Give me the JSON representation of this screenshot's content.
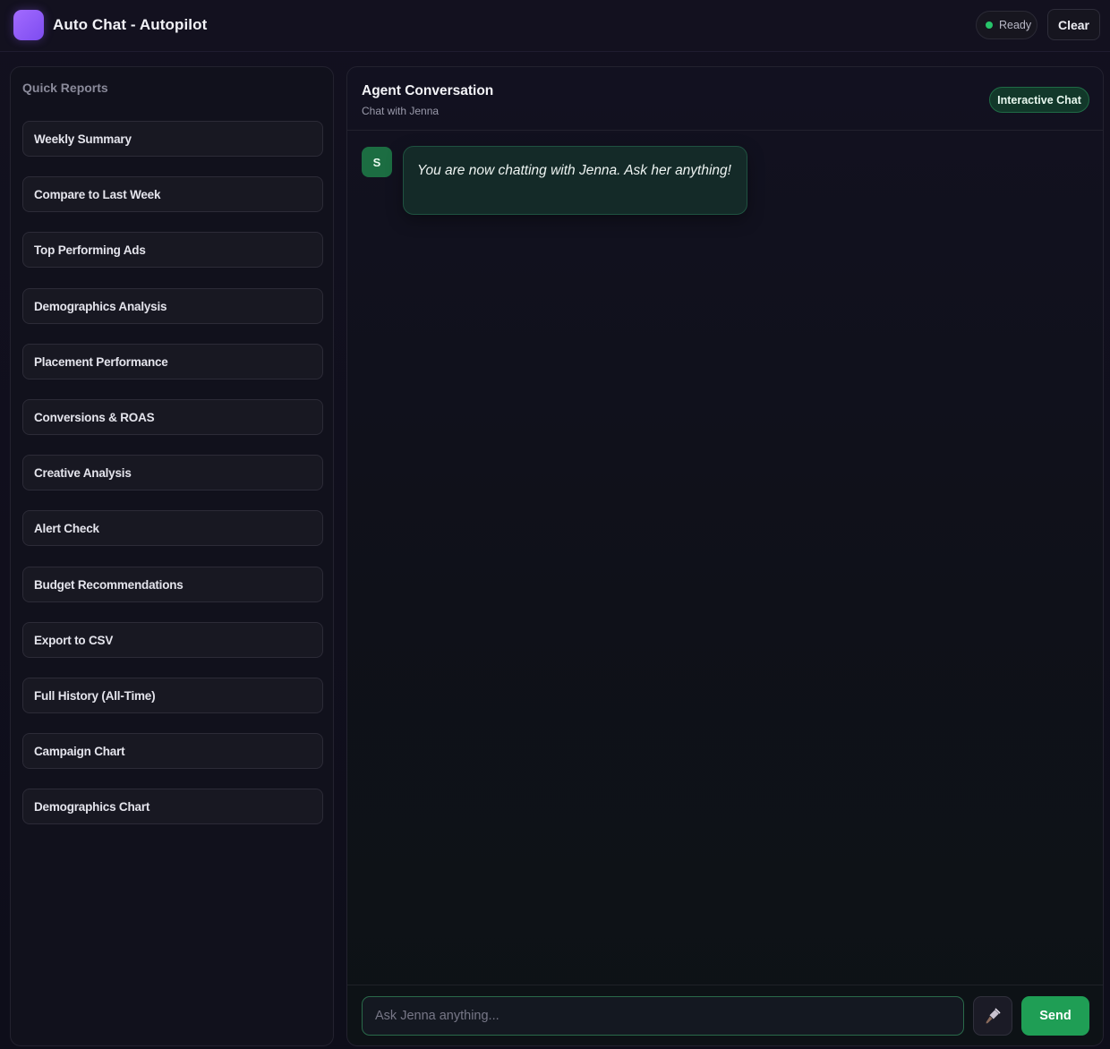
{
  "header": {
    "title": "Auto Chat - Autopilot",
    "status": "Ready",
    "status_color": "#27c46a",
    "clear_label": "Clear",
    "logo_icon": "logo-icon"
  },
  "sidebar": {
    "title": "Quick Reports",
    "items": [
      {
        "label": "Weekly Summary"
      },
      {
        "label": "Compare to Last Week"
      },
      {
        "label": "Top Performing Ads"
      },
      {
        "label": "Demographics Analysis"
      },
      {
        "label": "Placement Performance"
      },
      {
        "label": "Conversions & ROAS"
      },
      {
        "label": "Creative Analysis"
      },
      {
        "label": "Alert Check"
      },
      {
        "label": "Budget Recommendations"
      },
      {
        "label": "Export to CSV"
      },
      {
        "label": "Full History (All-Time)"
      },
      {
        "label": "Campaign Chart"
      },
      {
        "label": "Demographics Chart"
      }
    ]
  },
  "main": {
    "title": "Agent Conversation",
    "subtitle": "Chat with Jenna",
    "mode_badge": "Interactive Chat",
    "messages": [
      {
        "avatar": "S",
        "text": "You are now chatting with Jenna. Ask her anything!"
      }
    ],
    "input": {
      "placeholder": "Ask Jenna anything...",
      "value": ""
    },
    "tool_icon": "microphone-icon",
    "send_label": "Send",
    "accent_color": "#1f9e55"
  }
}
